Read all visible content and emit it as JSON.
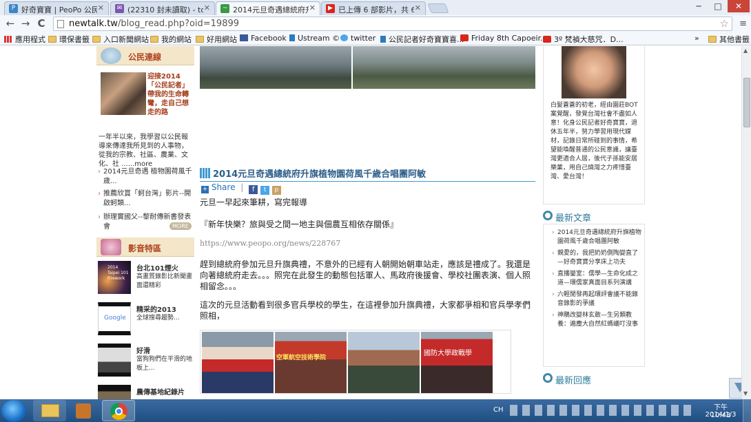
{
  "tabs": [
    {
      "label": "好奇寶寶 | PeoPo 公民新",
      "icon": "peopo-icon",
      "icon_color": "#3b86c6",
      "active": false
    },
    {
      "label": "(22310 封未讀取) - tchan",
      "icon": "mail-icon",
      "icon_color": "#7a58b0",
      "active": false
    },
    {
      "label": "2014元旦奇遇總統府升旗",
      "icon": "newtalk-icon",
      "icon_color": "#3a9a44",
      "active": true
    },
    {
      "label": "已上傳 6 部影片，共 6 部",
      "icon": "youtube-icon",
      "icon_color": "#d8261c",
      "active": false
    }
  ],
  "window_controls": {
    "minimize": "─",
    "maximize": "□",
    "close": "✕"
  },
  "toolbar": {
    "back": "←",
    "forward": "→",
    "reload": "C",
    "url_host": "newtalk.tw",
    "url_path": "/blog_read.php?oid=19899",
    "star": "☆",
    "menu": "≡"
  },
  "bookmarks": [
    {
      "label": "應用程式",
      "icon": "apps-icon"
    },
    {
      "label": "環保書籤",
      "icon": "folder-icon"
    },
    {
      "label": "入口新聞網站",
      "icon": "folder-icon"
    },
    {
      "label": "我的網站",
      "icon": "folder-icon"
    },
    {
      "label": "好用網站",
      "icon": "folder-icon"
    },
    {
      "label": "Facebook",
      "icon": "facebook-icon"
    },
    {
      "label": "Ustream ©",
      "icon": "ustream-icon"
    },
    {
      "label": "twitter",
      "icon": "twitter-icon"
    },
    {
      "label": "公民記者好奇寶寶喜...",
      "icon": "ustream-icon"
    },
    {
      "label": "Friday 8th Capoeir...",
      "icon": "youtube-icon"
    },
    {
      "label": "3º 梵禎大慈咒．D...",
      "icon": "youtube-icon"
    },
    {
      "label": "»",
      "icon": ""
    },
    {
      "label": "其他書籤",
      "icon": "folder-icon"
    }
  ],
  "left": {
    "citizen_head": "公民連線",
    "feature_title": "迎接2014「公民記者」帶我的生命轉彎，走自己想走的路",
    "feature_body": "一年半以來，我學習以公民報導來傳達我所見到的人事物，從我的宗教、社區、農業、文化、社 ......more",
    "items": [
      "2014元旦奇遇 植物園荷風千歲...",
      "推薦欣賞「蚵台灣」影片--開啟蚵類...",
      "辦理竇國父--黎耐傳新書發表會"
    ],
    "more": "MORE",
    "video_head": "影音特區",
    "videos": [
      {
        "title": "台北101煙火",
        "desc": "高畫質錄影比新聞畫面還精彩",
        "thumb_text": "2014 Taipei 101 Firework"
      },
      {
        "title": "精采的2013",
        "desc": "全球搜尋趨勢...",
        "thumb_text": "Google"
      },
      {
        "title": "好滑",
        "desc": "當狗狗們在平滑的地板上...",
        "thumb_text": ""
      },
      {
        "title": "農傳基地紀錄片",
        "desc": "",
        "thumb_text": ""
      }
    ]
  },
  "article": {
    "title": "2014元旦奇遇總統府升旗植物園荷風千歲合唱團阿敏",
    "share": "Share",
    "p1": "元旦一早起來筆耕，寫完報導",
    "p2": "『新年快樂？旅與受之間一地主與佃農互相依存關係』",
    "link": "https://www.peopo.org/news/228767",
    "p3": "趕到總統府參加元旦升旗典禮，不意外的已經有人朝開始朝車站走，應該是禮成了。我還是向著總統府走去。。。照完在此發生的動態包括軍人、馬政府後援會、學校社團表演、個人照相留念。。。",
    "p4": "這次的元旦活動看到很多官兵學校的學生，在這裡參加升旗典禮，大家都爭相和官兵學孝們照相，",
    "banner_caption": "空軍航空技術學院",
    "banner_caption2": "國防大學政戰學"
  },
  "right": {
    "profile": "白髮蒼蒼的初老，經由園莊BOT案覺醒，發覺台灣社會不盡如人意！化身公民記者好奇寶寶，退休五年半，努力學習用現代媒材，記錄日常所碰到的事情，希望能喚醒普通的公民意識，讓臺灣更適合人居，後代子孫能安居樂業，用自己燒灣之力疼惜臺灣、愛台灣！",
    "latest_head": "最新文章",
    "latest": [
      "2014元旦奇遇總統府升旗植物園荷風千歲合唱團阿敏",
      "親愛的，我把奶奶側陶變直了—好奇寶寶分享床上功夫",
      "直播鑾室：儒學—生命化成之道—環儒家真面目系列演講",
      "六輕閒發再起環評會議不能錄音錄影的爭議",
      "神鵰改變林玄敢—生另類教養：遍塵大自然紅螞蟻叮沒事"
    ],
    "reply_head": "最新回應"
  },
  "taskbar": {
    "lang": "CH",
    "time": "下午 10:43",
    "date": "2014/1/3"
  },
  "colors": {
    "accent_orange": "#b0441f",
    "link_blue": "#2e5f8a",
    "teal": "#2f7e9c"
  }
}
